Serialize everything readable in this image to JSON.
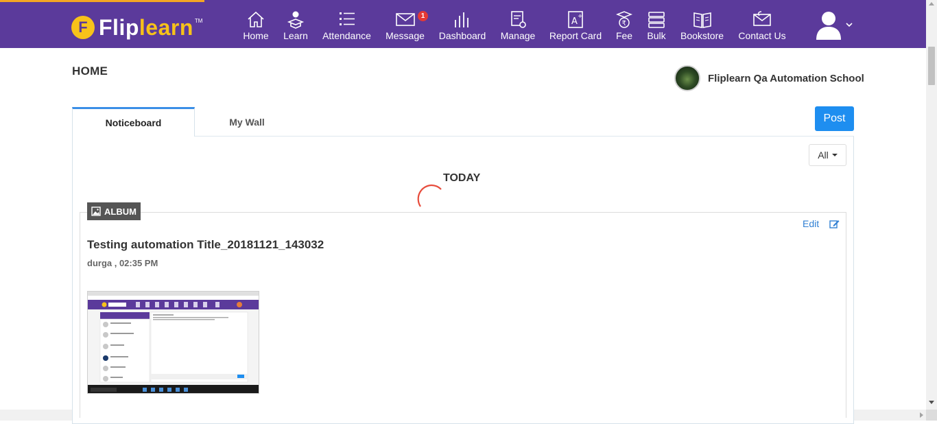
{
  "brand": {
    "logo_letter": "F",
    "name_part1": "Flip",
    "name_part2": "learn",
    "tm": "TM"
  },
  "nav": {
    "home": "Home",
    "learn": "Learn",
    "attendance": "Attendance",
    "message": "Message",
    "message_badge": "1",
    "dashboard": "Dashboard",
    "manage": "Manage",
    "report_card": "Report Card",
    "fee": "Fee",
    "bulk": "Bulk",
    "bookstore": "Bookstore",
    "contact_us": "Contact Us"
  },
  "page": {
    "title": "HOME",
    "school_name": "Fliplearn Qa Automation School"
  },
  "tabs": {
    "noticeboard": "Noticeboard",
    "my_wall": "My Wall"
  },
  "actions": {
    "post": "Post",
    "filter": "All"
  },
  "feed": {
    "section_heading": "TODAY",
    "post": {
      "type_label": "ALBUM",
      "edit_label": "Edit",
      "title": "Testing automation Title_20181121_143032",
      "meta": "durga , 02:35 PM"
    }
  },
  "colors": {
    "header": "#5b3a9b",
    "brand_yellow": "#f7c21a",
    "accent_blue": "#1e8ef0",
    "spinner": "#e74c3c"
  }
}
